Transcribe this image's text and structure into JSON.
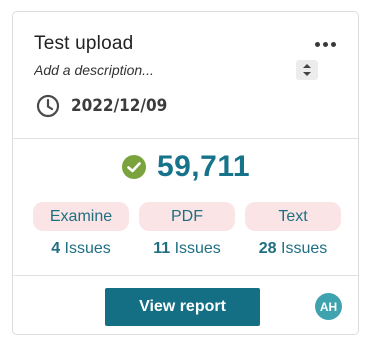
{
  "card": {
    "title": "Test upload",
    "description_placeholder": "Add a description...",
    "date": "2022/12/09",
    "score": "59,711",
    "categories": [
      {
        "label": "Examine",
        "count": "4",
        "issues_label": "Issues"
      },
      {
        "label": "PDF",
        "count": "11",
        "issues_label": "Issues"
      },
      {
        "label": "Text",
        "count": "28",
        "issues_label": "Issues"
      }
    ],
    "view_report_label": "View report",
    "avatar_initials": "AH"
  },
  "icons": {
    "more": "more-options-icon",
    "spinner": "up-down-spinner-icon",
    "clock": "clock-icon",
    "check": "check-circle-icon"
  },
  "colors": {
    "accent": "#146e84",
    "score_text": "#16738a",
    "pill_bg": "#fbe4e5",
    "check_green": "#7aa33e",
    "avatar_bg": "#3ea3ae"
  }
}
